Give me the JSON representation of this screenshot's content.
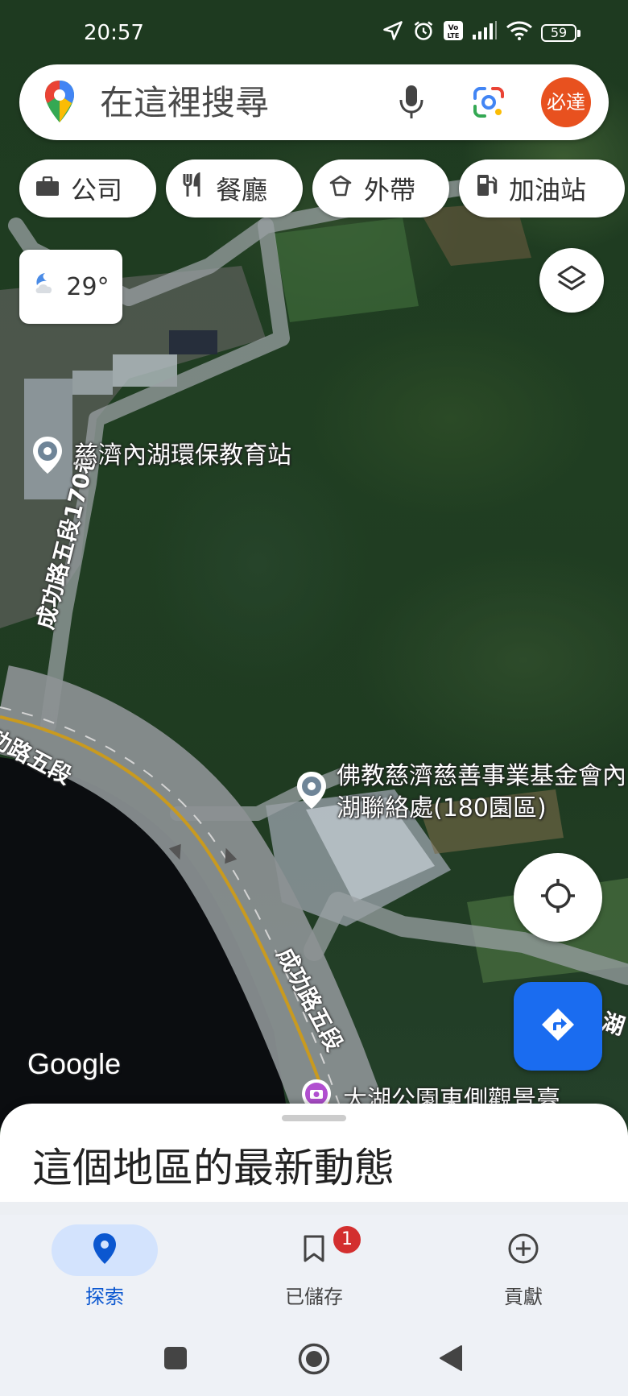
{
  "status_bar": {
    "time": "20:57",
    "battery": "59",
    "icons": [
      "location-arrow-icon",
      "alarm-icon",
      "volte-icon",
      "signal-icon",
      "wifi-icon",
      "battery-icon"
    ]
  },
  "search": {
    "placeholder": "在這裡搜尋",
    "avatar_text": "必達",
    "avatar_color": "#e8511f"
  },
  "chips": [
    {
      "label": "公司",
      "icon": "briefcase-icon"
    },
    {
      "label": "餐廳",
      "icon": "restaurant-icon"
    },
    {
      "label": "外帶",
      "icon": "takeout-icon"
    },
    {
      "label": "加油站",
      "icon": "gas-station-icon"
    }
  ],
  "weather": {
    "temperature": "29°",
    "icon": "moon-cloud-icon"
  },
  "map": {
    "road_labels": [
      "成功路五段170巷",
      "功路五段",
      "成功路五段",
      "湖"
    ],
    "pois": [
      {
        "label": "慈濟內湖環保教育站"
      },
      {
        "label": "佛教慈濟慈善事業基金會內湖聯絡處(180園區)"
      },
      {
        "label": "大湖公園東側觀景臺"
      }
    ],
    "watermark": "Google"
  },
  "sheet": {
    "title": "這個地區的最新動態"
  },
  "bottom_nav": {
    "items": [
      {
        "label": "探索",
        "icon": "location-pin-icon",
        "active": true
      },
      {
        "label": "已儲存",
        "icon": "bookmark-icon",
        "badge": "1"
      },
      {
        "label": "貢獻",
        "icon": "add-circle-icon"
      }
    ]
  },
  "colors": {
    "accent": "#1a6cf0",
    "active_tab_bg": "#d3e3fd",
    "badge": "#d32f2f"
  }
}
